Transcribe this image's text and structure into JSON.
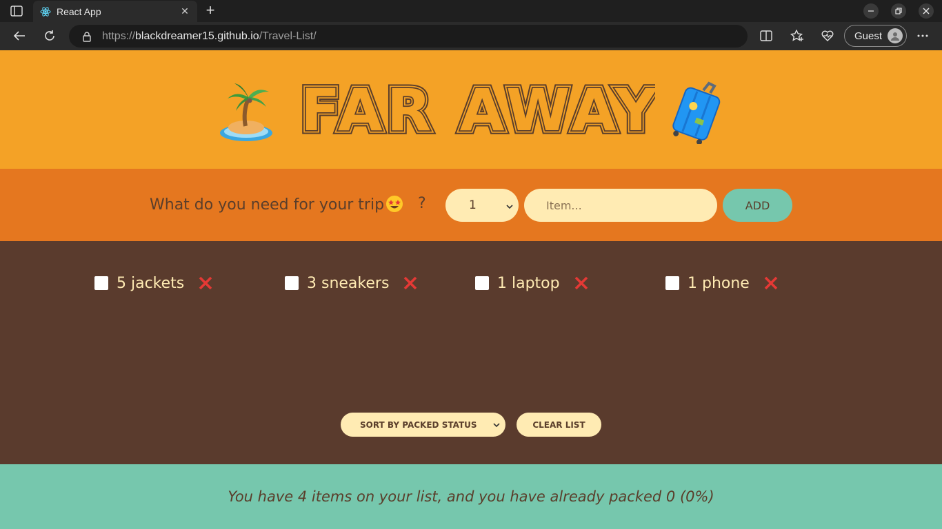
{
  "browser": {
    "tab_title": "React App",
    "url_prefix": "https://",
    "url_host": "blackdreamer15.github.io",
    "url_path": "/Travel-List/",
    "profile_label": "Guest",
    "icons": {
      "tab_actions": "tab-actions-icon",
      "favicon": "react-icon",
      "tab_close": "close-icon",
      "new_tab": "plus-icon",
      "minimize": "minimize-icon",
      "restore": "restore-icon",
      "close_window": "close-icon",
      "back": "back-arrow-icon",
      "reload": "reload-icon",
      "lock": "lock-icon",
      "split_screen": "split-screen-icon",
      "favorites": "star-icon",
      "copilot": "heart-pulse-icon",
      "more": "more-icon"
    }
  },
  "header": {
    "title": "FAR AWAY",
    "left_emoji": "palm-island-emoji",
    "right_emoji": "luggage-emoji"
  },
  "form": {
    "question": "What do you need for your trip",
    "question_emoji": "star-struck-emoji",
    "question_mark": "?",
    "quantity_value": "1",
    "item_placeholder": "Item...",
    "add_label": "ADD"
  },
  "items": [
    {
      "description": "5 jackets",
      "packed": false
    },
    {
      "description": "3 sneakers",
      "packed": false
    },
    {
      "description": "1 laptop",
      "packed": false
    },
    {
      "description": "1 phone",
      "packed": false
    }
  ],
  "actions": {
    "sort_value": "SORT BY PACKED STATUS",
    "clear_label": "CLEAR LIST"
  },
  "stats": {
    "text": "You have 4 items on your list, and you have already packed 0 (0%)"
  },
  "colors": {
    "header_bg": "#f4a226",
    "form_bg": "#e5771f",
    "list_bg": "#5a3b2d",
    "stats_bg": "#76c7ad",
    "text_dark": "#5a3e2b",
    "pill_bg": "#ffebb3",
    "delete_red": "#e53935"
  }
}
